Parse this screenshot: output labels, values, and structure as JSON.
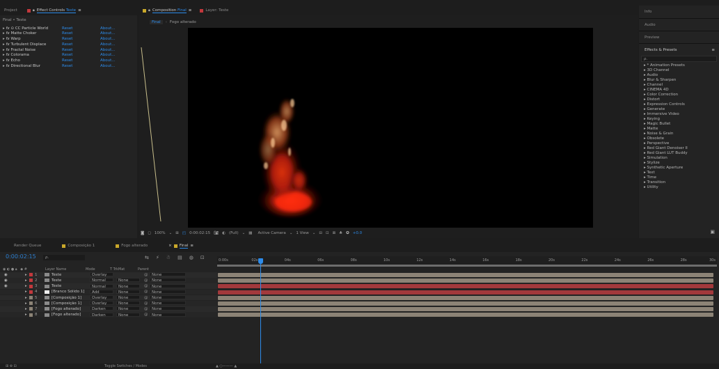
{
  "left_panel": {
    "tabs": [
      "Project",
      "Effect Controls",
      "Teste"
    ],
    "breadcrumb": "Final • Teste",
    "effects": [
      {
        "name": "CC Particle World",
        "reset": "Reset",
        "about": "About..."
      },
      {
        "name": "Matte Choker",
        "reset": "Reset",
        "about": "About..."
      },
      {
        "name": "Warp",
        "reset": "Reset",
        "about": "About..."
      },
      {
        "name": "Turbulent Displace",
        "reset": "Reset",
        "about": "About..."
      },
      {
        "name": "Fractal Noise",
        "reset": "Reset",
        "about": "About..."
      },
      {
        "name": "Colorama",
        "reset": "Reset",
        "about": "About..."
      },
      {
        "name": "Echo",
        "reset": "Reset",
        "about": "About..."
      },
      {
        "name": "Directional Blur",
        "reset": "Reset",
        "about": "About..."
      }
    ]
  },
  "comp_panel": {
    "tab_label": "Composition",
    "tab_name": "Final",
    "layer_tab": "Layer: Teste",
    "crumbs": [
      "Final",
      "Fogo alterado"
    ]
  },
  "viewer_toolbar": {
    "zoom": "100%",
    "timecode": "0:00:02:15",
    "resolution": "(Full)",
    "camera": "Active Camera",
    "view": "1 View",
    "exposure": "+0.0"
  },
  "right_panel": {
    "tabs": [
      "Info",
      "Audio",
      "Preview",
      "Effects & Presets"
    ],
    "search_placeholder": "ρ.",
    "categories": [
      "* Animation Presets",
      "3D Channel",
      "Audio",
      "Blur & Sharpen",
      "Channel",
      "CINEMA 4D",
      "Color Correction",
      "Distort",
      "Expression Controls",
      "Generate",
      "Immersive Video",
      "Keying",
      "Magic Bullet",
      "Matte",
      "Noise & Grain",
      "Obsolete",
      "Perspective",
      "Red Giant Denoiser II",
      "Red Giant LUT Buddy",
      "Simulation",
      "Stylize",
      "Synthetic Aperture",
      "Text",
      "Time",
      "Transition",
      "Utility"
    ]
  },
  "timeline": {
    "tabs": [
      "Render Queue",
      "Composição 1",
      "Fogo alterado",
      "Final"
    ],
    "timecode": "0:00:02:15",
    "search_placeholder": "ρ.",
    "headers": {
      "layer_name": "Layer Name",
      "mode": "Mode",
      "trkmat": "T  TrkMat",
      "parent": "Parent"
    },
    "ticks": [
      "0:00s",
      "02s",
      "04s",
      "06s",
      "08s",
      "10s",
      "12s",
      "14s",
      "16s",
      "18s",
      "20s",
      "22s",
      "24s",
      "26s",
      "28s",
      "30s"
    ],
    "layers": [
      {
        "num": "1",
        "name": "Teste",
        "mode": "Overlay",
        "trkmat": "",
        "parent": "None",
        "color": "#c2383c",
        "bar": "#8c8376"
      },
      {
        "num": "2",
        "name": "Teste",
        "mode": "Normal",
        "trkmat": "None",
        "parent": "None",
        "color": "#c2383c",
        "bar": "#8c8376"
      },
      {
        "num": "3",
        "name": "Teste",
        "mode": "Normal",
        "trkmat": "None",
        "parent": "None",
        "color": "#c2383c",
        "bar": "#a2393c"
      },
      {
        "num": "4",
        "name": "[Branco Sólido 1]",
        "mode": "Add",
        "trkmat": "None",
        "parent": "None",
        "color": "#c2383c",
        "bar": "#a2393c"
      },
      {
        "num": "5",
        "name": "[Composição 1]",
        "mode": "Overlay",
        "trkmat": "None",
        "parent": "None",
        "color": "#8c8376",
        "bar": "#8c8376"
      },
      {
        "num": "6",
        "name": "[Composição 1]",
        "mode": "Overlay",
        "trkmat": "None",
        "parent": "None",
        "color": "#8c8376",
        "bar": "#8c8376"
      },
      {
        "num": "7",
        "name": "[Fogo alterado]",
        "mode": "Darken",
        "trkmat": "None",
        "parent": "None",
        "color": "#8c8376",
        "bar": "#8c8376"
      },
      {
        "num": "8",
        "name": "[Fogo alterado]",
        "mode": "Darken",
        "trkmat": "None",
        "parent": "None",
        "color": "#8c8376",
        "bar": "#8c8376"
      }
    ],
    "footer_label": "Toggle Switches / Modes"
  }
}
